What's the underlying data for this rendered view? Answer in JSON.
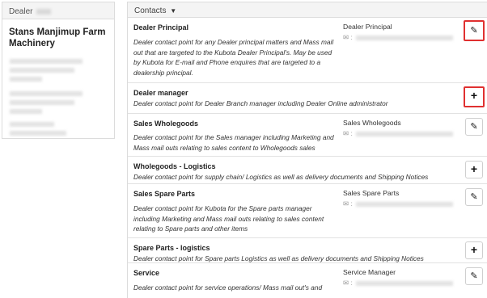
{
  "dealer": {
    "header_label": "Dealer",
    "name": "Stans Manjimup Farm Machinery"
  },
  "contacts": {
    "header_label": "Contacts",
    "rows": [
      {
        "title": "Dealer Principal",
        "description": "Dealer contact point for any Dealer principal matters and Mass mail out that are targeted to the Kubota Dealer Principal's. May be used by Kubota for E-mail and Phone enquires that are targeted to a dealership principal.",
        "role": "Dealer Principal",
        "email_prefix": "✉ :",
        "action": "edit-icon"
      },
      {
        "title": "Dealer manager",
        "description": "Dealer contact point for Dealer Branch manager including Dealer Online administrator",
        "role": "",
        "action": "plus-icon"
      },
      {
        "title": "Sales Wholegoods",
        "description": "Dealer contact point for the Sales manager including Marketing and Mass mail outs relating to sales content to Wholegoods sales",
        "role": "Sales Wholegoods",
        "email_prefix": "✉ :",
        "action": "edit-icon"
      },
      {
        "title": "Wholegoods - Logistics",
        "description": "Dealer contact point for supply chain/ Logistics as well as delivery documents and Shipping Notices",
        "role": "",
        "action": "plus-icon"
      },
      {
        "title": "Sales Spare Parts",
        "description": "Dealer contact point for Kubota for the Spare parts manager including Marketing and Mass mail outs relating to sales content relating to Spare parts and other items",
        "role": "Sales Spare Parts",
        "email_prefix": "✉ :",
        "action": "edit-icon"
      },
      {
        "title": "Spare Parts - logistics",
        "description": "Dealer contact point for Spare parts Logistics as well as delivery documents and Shipping Notices",
        "role": "",
        "action": "plus-icon"
      },
      {
        "title": "Service",
        "description": "Dealer contact point for service operations/ Mass mail out's and",
        "role": "Service Manager",
        "email_prefix": "✉ :",
        "action": "edit-icon"
      }
    ]
  },
  "icons": {
    "edit": "✎",
    "plus": "+",
    "chevron": "⌄"
  },
  "colors": {
    "highlight": "#e03030"
  }
}
